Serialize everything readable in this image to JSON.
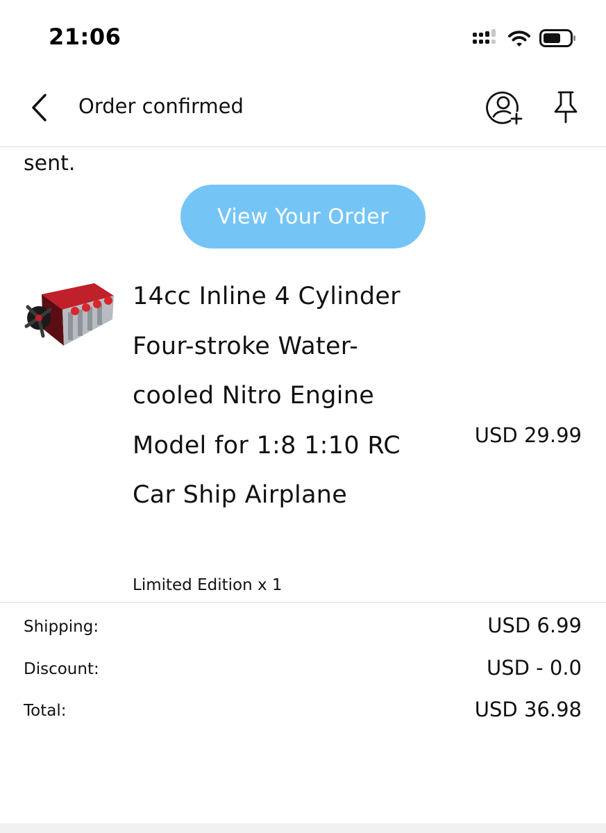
{
  "status_bar": {
    "time": "21:06",
    "icons": [
      "cellular-signal-icon",
      "wifi-icon",
      "battery-icon"
    ]
  },
  "header": {
    "title": "Order confirmed",
    "back_icon": "chevron-left-icon",
    "actions": [
      "add-contact-icon",
      "pin-icon"
    ]
  },
  "content": {
    "intro_tail": "sent.",
    "view_order_label": "View Your Order",
    "view_order_color": "#74c5f6"
  },
  "product": {
    "image_icon": "engine-model-image",
    "title": "14cc Inline 4 Cylinder Four-stroke Water-cooled Nitro Engine Model for 1:8 1:10 RC Car Ship Airplane",
    "variant": "Limited Edition x 1",
    "price": "USD 29.99"
  },
  "summary": {
    "shipping_label": "Shipping:",
    "shipping_value": "USD 6.99",
    "discount_label": "Discount:",
    "discount_value": "USD - 0.0",
    "total_label": "Total:",
    "total_value": "USD 36.98"
  }
}
